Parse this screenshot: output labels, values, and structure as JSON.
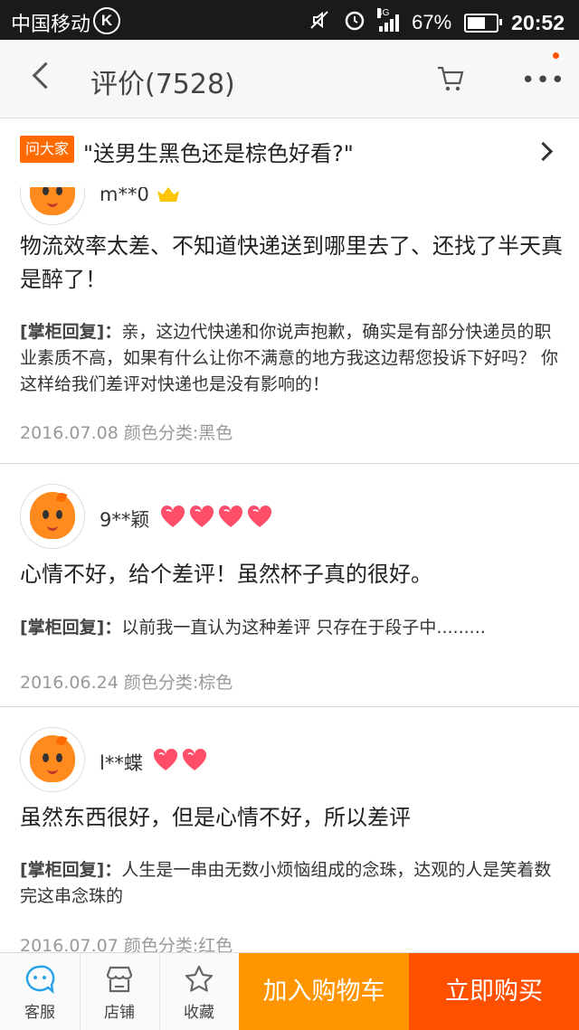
{
  "status_bar": {
    "carrier": "中国移动",
    "carrier_icon": "K",
    "network": "4G",
    "battery": "67%",
    "battery_level": 0.67,
    "time": "20:52"
  },
  "header": {
    "title": "评价(7528)",
    "icons": [
      "back-icon",
      "cart-icon",
      "more-icon"
    ]
  },
  "question_bar": {
    "badge": "问大家",
    "question": "\"送男生黑色还是棕色好看?\""
  },
  "reviews": [
    {
      "username": "m**0",
      "level_icon": "crown-icon",
      "content": "物流效率太差、不知道快递送到哪里去了、还找了半天真是醉了！",
      "reply_label": "[掌柜回复]：",
      "reply_text": "亲，这边代快递和你说声抱歉，确实是有部分快递员的职业素质不高，如果有什么让你不满意的地方我这边帮您投诉下好吗？ 你这样给我们差评对快递也是没有影响的！",
      "date": "2016.07.08",
      "sku": "颜色分类:黑色"
    },
    {
      "username": "9**颖",
      "hearts": 4,
      "content": "心情不好，给个差评！虽然杯子真的很好。",
      "reply_label": "[掌柜回复]：",
      "reply_text": "以前我一直认为这种差评  只存在于段子中.........",
      "date": "2016.06.24",
      "sku": "颜色分类:棕色"
    },
    {
      "username": "l**蝶",
      "hearts": 2,
      "content": "虽然东西很好，但是心情不好，所以差评",
      "reply_label": "[掌柜回复]：",
      "reply_text": "人生是一串由无数小烦恼组成的念珠，达观的人是笑着数完这串念珠的",
      "date": "2016.07.07",
      "sku": "颜色分类:红色"
    }
  ],
  "tabbar": {
    "service": "客服",
    "shop": "店铺",
    "favorite": "收藏",
    "add_to_cart": "加入购物车",
    "buy_now": "立即购买"
  },
  "colors": {
    "accent_orange": "#ff9500",
    "accent_red": "#ff5000",
    "heart": "#ff4d6a"
  }
}
